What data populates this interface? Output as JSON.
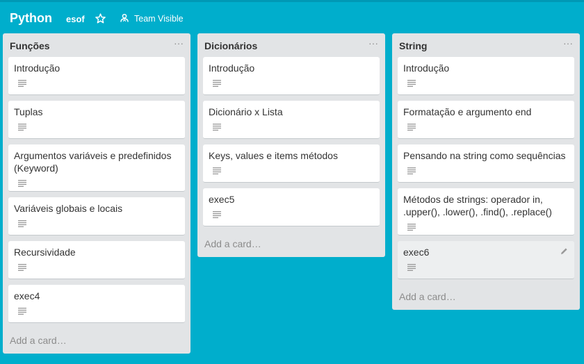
{
  "header": {
    "board_title": "Python",
    "org": "esof",
    "visibility": "Team Visible",
    "icons": [
      "star-icon",
      "team-icon"
    ]
  },
  "lists": [
    {
      "title": "Funções",
      "cards": [
        {
          "title": "Introdução"
        },
        {
          "title": "Tuplas"
        },
        {
          "title": "Argumentos variáveis e predefinidos (Keyword)"
        },
        {
          "title": "Variáveis globais e locais"
        },
        {
          "title": "Recursividade"
        },
        {
          "title": "exec4"
        }
      ],
      "add_card": "Add a card…"
    },
    {
      "title": "Dicionários",
      "cards": [
        {
          "title": "Introdução"
        },
        {
          "title": "Dicionário x Lista"
        },
        {
          "title": "Keys, values e items métodos"
        },
        {
          "title": "exec5"
        }
      ],
      "add_card": "Add a card…"
    },
    {
      "title": "String",
      "cards": [
        {
          "title": "Introdução"
        },
        {
          "title": "Formatação e argumento end"
        },
        {
          "title": "Pensando na string como sequências"
        },
        {
          "title": "Métodos de strings: operador in, .upper(), .lower(), .find(), .replace()"
        },
        {
          "title": "exec6"
        }
      ],
      "add_card": "Add a card…"
    }
  ],
  "list_menu_glyph": "···",
  "colors": {
    "background": "#00aecc",
    "list_bg": "#e2e4e6",
    "card_bg": "#ffffff",
    "text": "#333333",
    "muted": "#8c8c8c"
  }
}
